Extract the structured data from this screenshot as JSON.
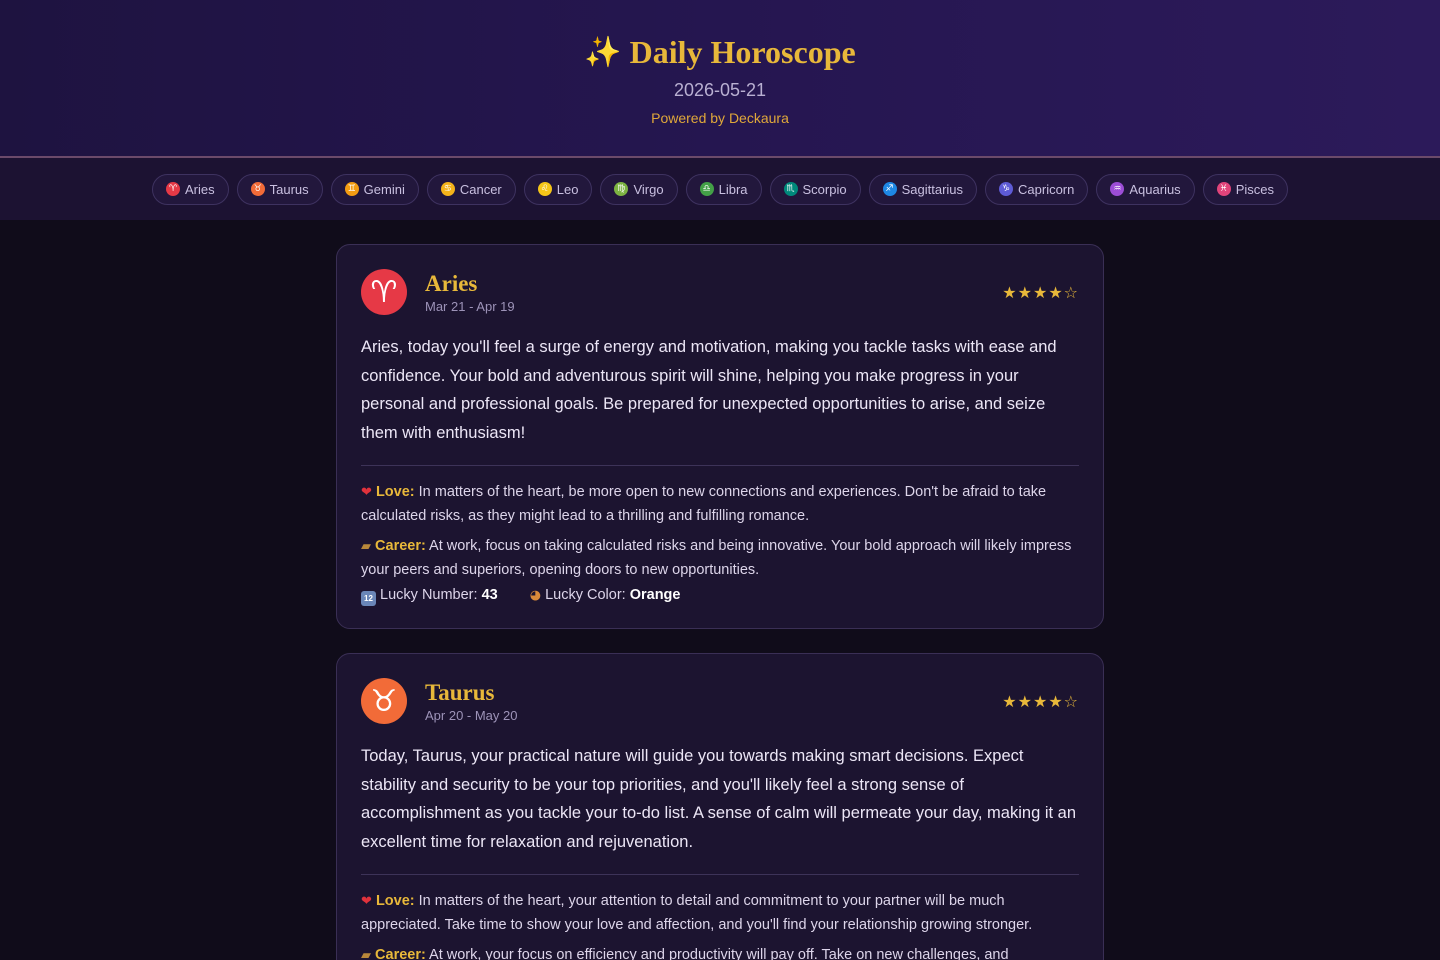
{
  "header": {
    "sparkle_icon": "sparkles-icon",
    "title": "Daily Horoscope",
    "date": "2026-05-21",
    "powered_by": "Powered by Deckaura"
  },
  "nav": [
    {
      "label": "Aries",
      "symbol": "♈",
      "color": "#e63946"
    },
    {
      "label": "Taurus",
      "symbol": "♉",
      "color": "#f26b38"
    },
    {
      "label": "Gemini",
      "symbol": "♊",
      "color": "#f39c12"
    },
    {
      "label": "Cancer",
      "symbol": "♋",
      "color": "#f5b31a"
    },
    {
      "label": "Leo",
      "symbol": "♌",
      "color": "#f5c518"
    },
    {
      "label": "Virgo",
      "symbol": "♍",
      "color": "#7cb342"
    },
    {
      "label": "Libra",
      "symbol": "♎",
      "color": "#43a047"
    },
    {
      "label": "Scorpio",
      "symbol": "♏",
      "color": "#00897b"
    },
    {
      "label": "Sagittarius",
      "symbol": "♐",
      "color": "#1e88e5"
    },
    {
      "label": "Capricorn",
      "symbol": "♑",
      "color": "#5e5bd6"
    },
    {
      "label": "Aquarius",
      "symbol": "♒",
      "color": "#9c4dd6"
    },
    {
      "label": "Pisces",
      "symbol": "♓",
      "color": "#e0447a"
    }
  ],
  "cards": [
    {
      "name": "Aries",
      "symbol": "♈",
      "color": "#e63946",
      "range": "Mar 21 - Apr 19",
      "stars": "★★★★☆",
      "summary": "Aries, today you'll feel a surge of energy and motivation, making you tackle tasks with ease and confidence. Your bold and adventurous spirit will shine, helping you make progress in your personal and professional goals. Be prepared for unexpected opportunities to arise, and seize them with enthusiasm!",
      "love_label": "Love:",
      "love": "In matters of the heart, be more open to new connections and experiences. Don't be afraid to take calculated risks, as they might lead to a thrilling and fulfilling romance.",
      "career_label": "Career:",
      "career": "At work, focus on taking calculated risks and being innovative. Your bold approach will likely impress your peers and superiors, opening doors to new opportunities.",
      "lucky_number_label": "Lucky Number:",
      "lucky_number": "43",
      "lucky_color_label": "Lucky Color:",
      "lucky_color": "Orange"
    },
    {
      "name": "Taurus",
      "symbol": "♉",
      "color": "#f26b38",
      "range": "Apr 20 - May 20",
      "stars": "★★★★☆",
      "summary": "Today, Taurus, your practical nature will guide you towards making smart decisions. Expect stability and security to be your top priorities, and you'll likely feel a strong sense of accomplishment as you tackle your to-do list. A sense of calm will permeate your day, making it an excellent time for relaxation and rejuvenation.",
      "love_label": "Love:",
      "love": "In matters of the heart, your attention to detail and commitment to your partner will be much appreciated. Take time to show your love and affection, and you'll find your relationship growing stronger.",
      "career_label": "Career:",
      "career": "At work, your focus on efficiency and productivity will pay off. Take on new challenges, and"
    }
  ]
}
